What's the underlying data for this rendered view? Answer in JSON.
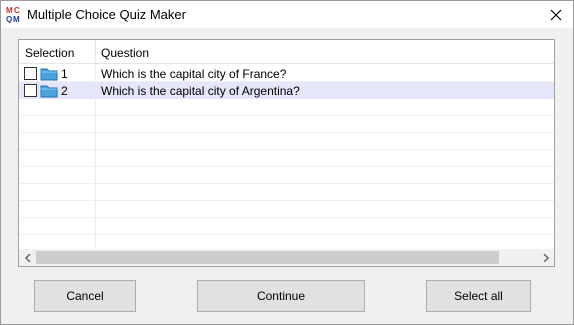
{
  "window": {
    "title": "Multiple Choice Quiz Maker",
    "app_icon": "mcqm-logo-icon",
    "close_icon": "close-icon"
  },
  "list": {
    "columns": [
      "Selection",
      "Question"
    ],
    "rows": [
      {
        "number": "1",
        "question": "Which is the capital city of France?",
        "checked": false,
        "selected": false,
        "icon": "folder-icon"
      },
      {
        "number": "2",
        "question": "Which is the capital city of Argentina?",
        "checked": false,
        "selected": true,
        "icon": "folder-icon"
      }
    ],
    "selected_row_color": "#e5e5fb"
  },
  "buttons": {
    "cancel": "Cancel",
    "continue": "Continue",
    "select_all": "Select all"
  }
}
